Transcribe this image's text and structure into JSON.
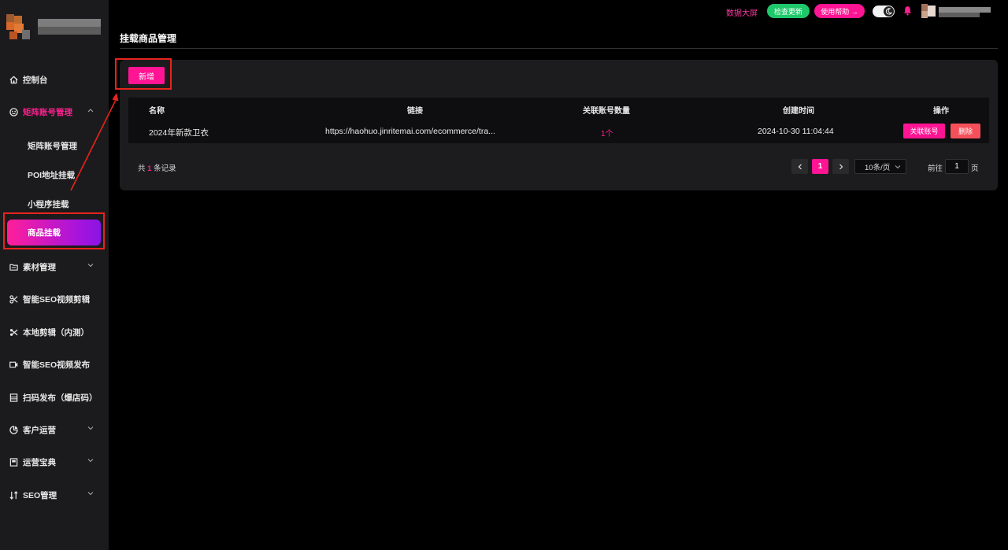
{
  "topbar": {
    "dashboard_link": "数据大屏",
    "check_update": "检查更新",
    "help": "使用帮助 →",
    "colors": {
      "update": "#1ec86a",
      "help": "#ff1493"
    }
  },
  "sidebar": {
    "items": [
      {
        "label": "控制台",
        "icon": "home-icon"
      },
      {
        "label": "矩阵账号管理",
        "icon": "smiley-icon",
        "expanded": true
      },
      {
        "label": "素材管理",
        "icon": "folder-icon"
      },
      {
        "label": "智能SEO视频剪辑",
        "icon": "cut-icon"
      },
      {
        "label": "本地剪辑（内测）",
        "icon": "scissors-icon"
      },
      {
        "label": "智能SEO视频发布",
        "icon": "video-icon"
      },
      {
        "label": "扫码发布（爆店码）",
        "icon": "qrcode-icon"
      },
      {
        "label": "客户运营",
        "icon": "pie-icon"
      },
      {
        "label": "运营宝典",
        "icon": "book-icon"
      },
      {
        "label": "SEO管理",
        "icon": "sort-icon"
      }
    ],
    "sub_items": [
      {
        "label": "矩阵账号管理"
      },
      {
        "label": "POI地址挂载"
      },
      {
        "label": "小程序挂载"
      },
      {
        "label": "商品挂载",
        "active": true
      }
    ]
  },
  "main": {
    "title": "挂载商品管理",
    "add_button": "新增",
    "table": {
      "columns": [
        "名称",
        "链接",
        "关联账号数量",
        "创建时间",
        "操作"
      ],
      "rows": [
        {
          "name": "2024年新款卫衣",
          "link": "https://haohuo.jinritemai.com/ecommerce/tra...",
          "count": "1个",
          "created": "2024-10-30 11:04:44",
          "link_account_btn": "关联账号",
          "delete_btn": "删除"
        }
      ]
    },
    "pagination": {
      "total_prefix": "共",
      "total": "1",
      "total_suffix": "条记录",
      "current_page": "1",
      "page_size": "10条/页",
      "goto_prefix": "前往",
      "goto_value": "1",
      "goto_suffix": "页"
    }
  }
}
